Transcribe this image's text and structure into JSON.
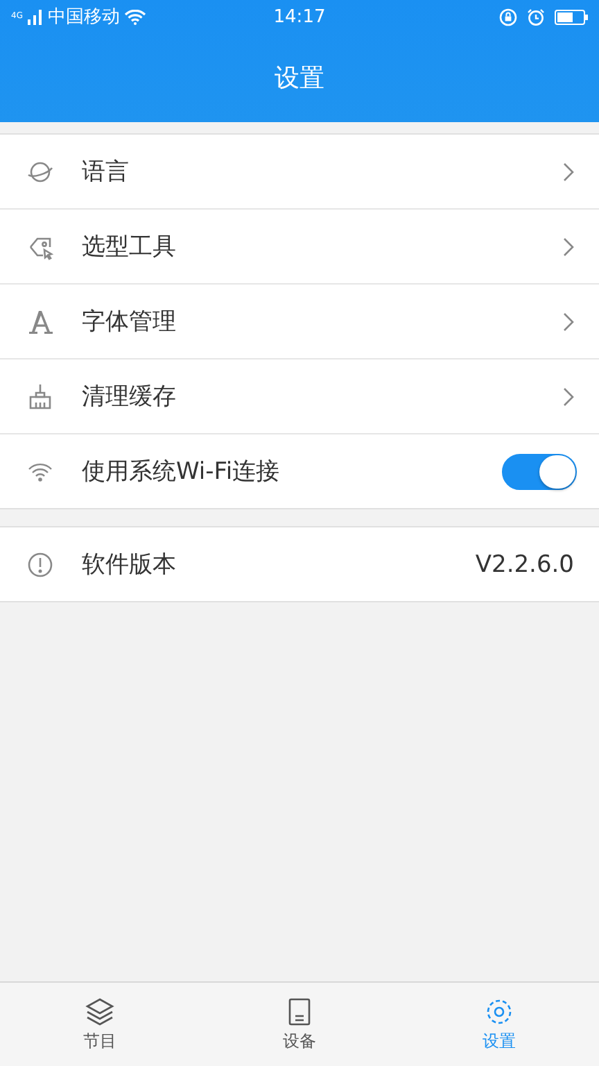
{
  "status_bar": {
    "network": "4G",
    "carrier": "中国移动",
    "time": "14:17"
  },
  "header": {
    "title": "设置"
  },
  "sections": [
    {
      "items": [
        {
          "label": "语言",
          "kind": "link"
        },
        {
          "label": "选型工具",
          "kind": "link"
        },
        {
          "label": "字体管理",
          "kind": "link"
        },
        {
          "label": "清理缓存",
          "kind": "link"
        },
        {
          "label": "使用系统Wi-Fi连接",
          "kind": "toggle",
          "on": true
        }
      ]
    },
    {
      "items": [
        {
          "label": "软件版本",
          "kind": "value",
          "value": "V2.2.6.0"
        }
      ]
    }
  ],
  "tab_bar": [
    {
      "label": "节目",
      "selected": false
    },
    {
      "label": "设备",
      "selected": false
    },
    {
      "label": "设置",
      "selected": true
    }
  ]
}
